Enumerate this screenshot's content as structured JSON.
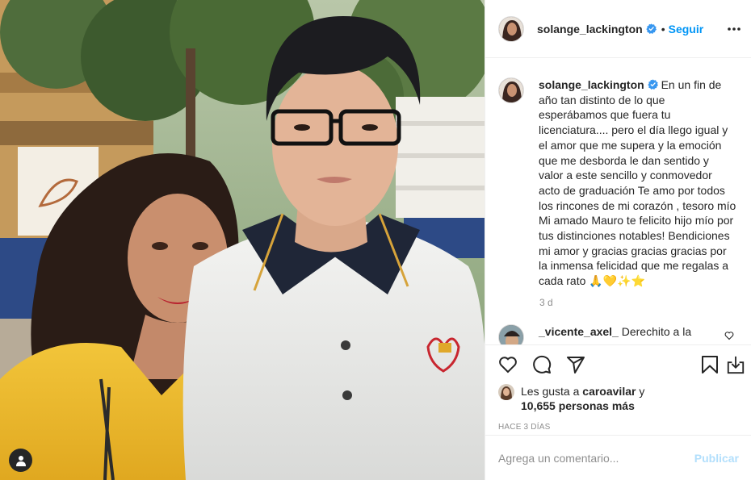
{
  "post": {
    "username": "solange_lackington",
    "follow_label": "Seguir",
    "dot": "•",
    "caption": "En un fin de año tan distinto de lo que esperábamos que fuera tu licenciatura.... pero el día llego igual y el amor que me supera y la emoción que me desborda le dan sentido y valor a este sencillo y conmovedor acto de graduación Te amo por todos los rincones de mi corazón , tesoro mío Mi amado Mauro te felicito hijo mío por tus distinciones notables! Bendiciones mi amor y gracias gracias gracias por la inmensa felicidad que me regalas a cada rato 🙏💛✨⭐",
    "caption_time": "3 d"
  },
  "comments": [
    {
      "username": "_vicente_axel_",
      "text": "Derechito a la"
    }
  ],
  "likes": {
    "prefix": "Les gusta a",
    "liker": "caroavilar",
    "and": "y",
    "others": "10,655 personas más"
  },
  "posted_ago": "Hace 3 días",
  "comment_box": {
    "placeholder": "Agrega un comentario...",
    "publish_label": "Publicar"
  },
  "colors": {
    "accent": "#0095f6",
    "publish_disabled": "#b2dffc",
    "muted": "#8e8e8e",
    "border": "#efefef"
  },
  "icons": [
    "more-options-icon",
    "verified-badge-icon",
    "like-heart-icon",
    "comment-bubble-icon",
    "share-plane-icon",
    "save-bookmark-icon",
    "download-icon",
    "user-tag-icon",
    "comment-like-icon"
  ]
}
